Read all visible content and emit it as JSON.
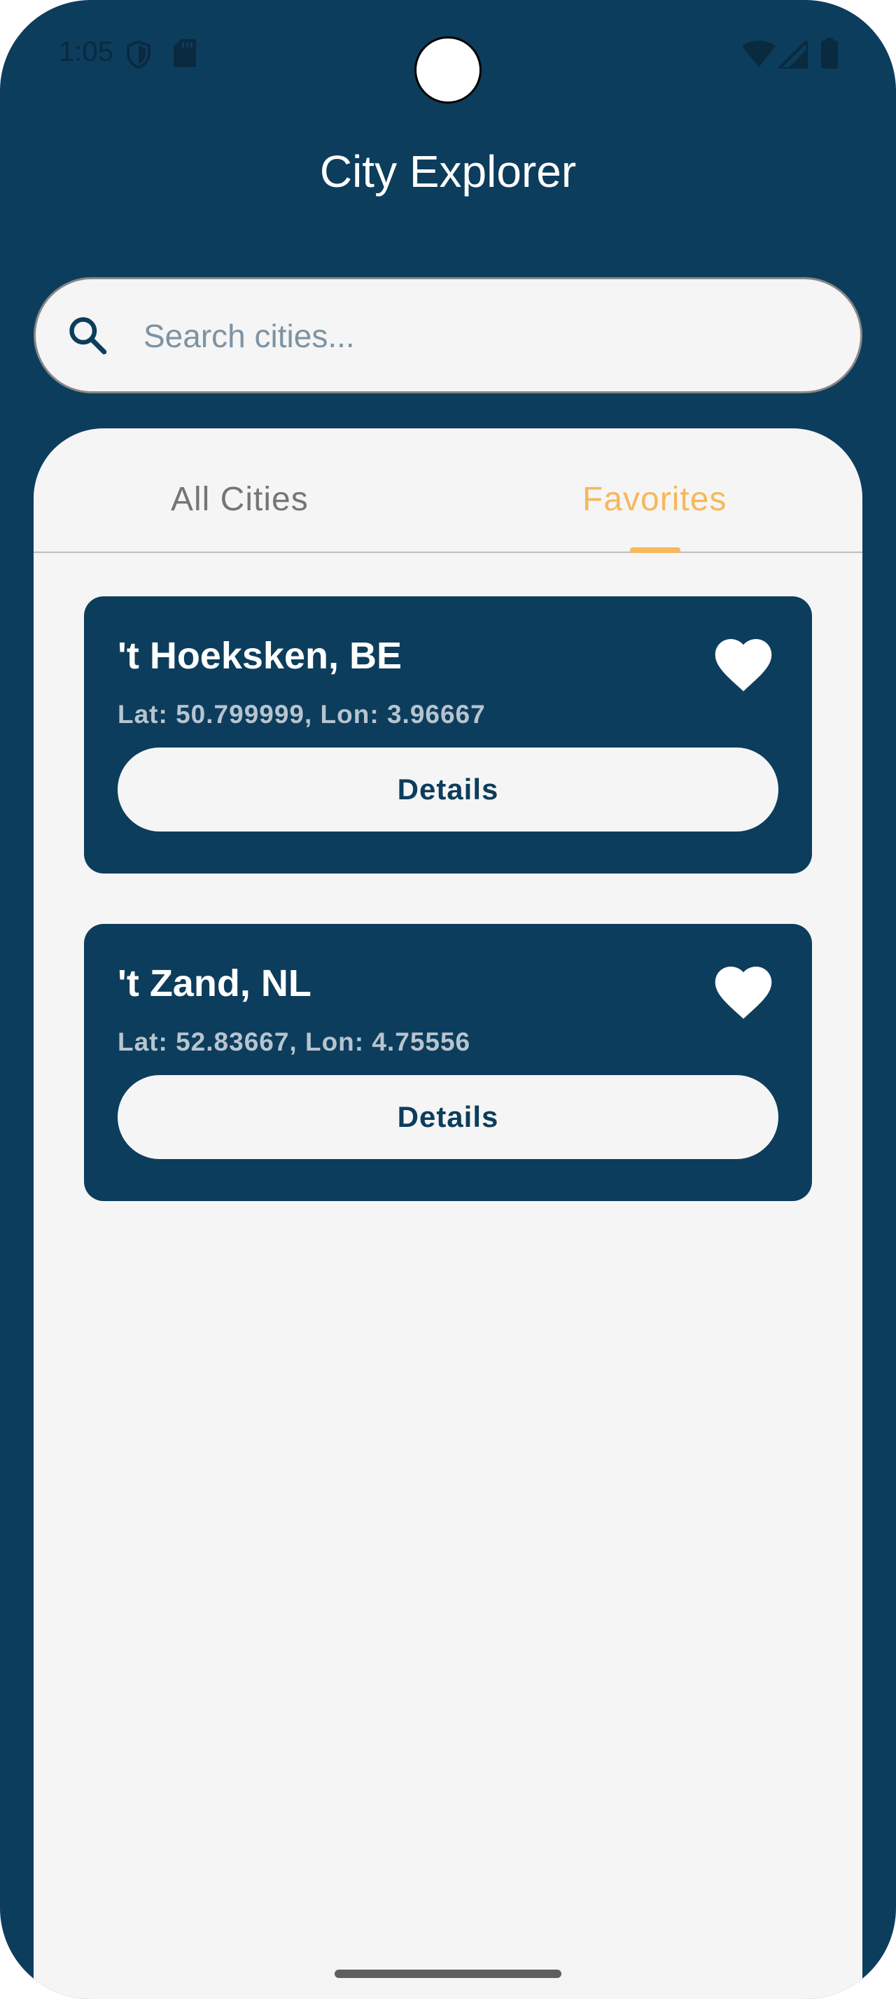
{
  "status_bar": {
    "time": "1:05",
    "icons": [
      "shield-icon",
      "sd-card-icon",
      "wifi-icon",
      "signal-icon",
      "battery-icon"
    ]
  },
  "header": {
    "title": "City Explorer"
  },
  "search": {
    "placeholder": "Search cities...",
    "value": "",
    "icon": "search-icon"
  },
  "tabs": [
    {
      "label": "All Cities",
      "selected": false
    },
    {
      "label": "Favorites",
      "selected": true
    }
  ],
  "cities": [
    {
      "name": "'t Hoeksken, BE",
      "coords": "Lat: 50.799999, Lon: 3.96667",
      "favorite": true,
      "button_label": "Details"
    },
    {
      "name": "'t Zand, NL",
      "coords": "Lat: 52.83667, Lon: 4.75556",
      "favorite": true,
      "button_label": "Details"
    }
  ],
  "colors": {
    "primary": "#0d3d5c",
    "accent": "#f7b85a",
    "surface": "#f5f5f5",
    "tab_inactive": "#757575"
  }
}
